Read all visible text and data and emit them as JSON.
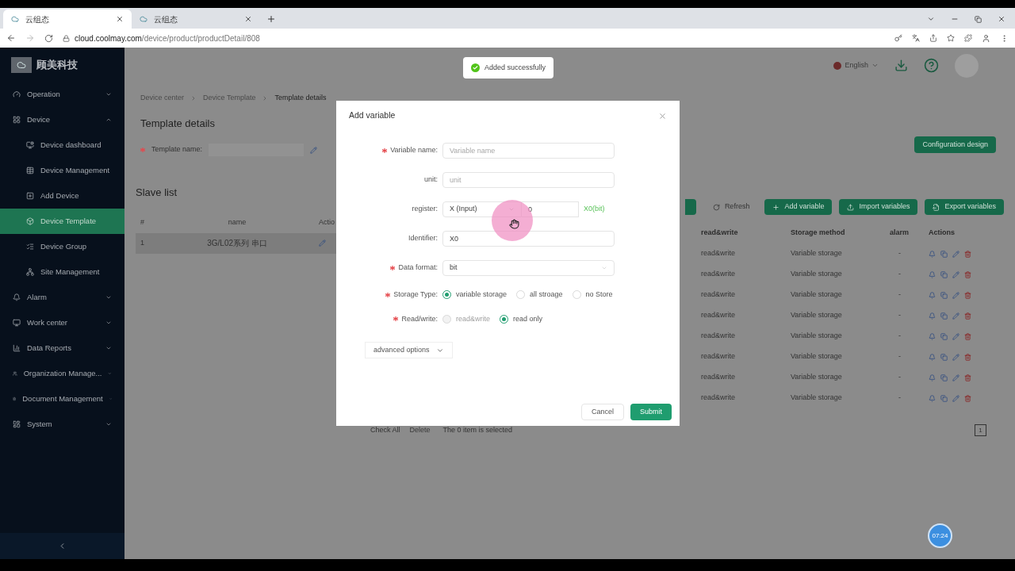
{
  "browser": {
    "tabs": [
      {
        "title": "云组态",
        "selected": true
      },
      {
        "title": "云组态",
        "selected": false
      }
    ],
    "url_host": "cloud.coolmay.com",
    "url_path": "/device/product/productDetail/808"
  },
  "logo_text": "顾美科技",
  "sidebar": [
    {
      "label": "Operation",
      "expanded": false,
      "selected": false
    },
    {
      "label": "Device",
      "expanded": true,
      "selected": false,
      "children": [
        {
          "label": "Device dashboard",
          "selected": false
        },
        {
          "label": "Device Management",
          "selected": false
        },
        {
          "label": "Add Device",
          "selected": false
        },
        {
          "label": "Device Template",
          "selected": true
        },
        {
          "label": "Device Group",
          "selected": false
        },
        {
          "label": "Site Management",
          "selected": false
        }
      ]
    },
    {
      "label": "Alarm",
      "expanded": false,
      "selected": false
    },
    {
      "label": "Work center",
      "expanded": false,
      "selected": false
    },
    {
      "label": "Data Reports",
      "expanded": false,
      "selected": false
    },
    {
      "label": "Organization Manage...",
      "expanded": false,
      "selected": false
    },
    {
      "label": "Document Management",
      "expanded": false,
      "selected": false
    },
    {
      "label": "System",
      "expanded": false,
      "selected": false
    }
  ],
  "header": {
    "language": "English"
  },
  "breadcrumb": [
    "Device center",
    "Device Template",
    "Template details"
  ],
  "page_title": "Template details",
  "template_name_label": "Template name:",
  "configuration_button": "Configuration design",
  "slave_list": {
    "title": "Slave list",
    "columns": [
      "#",
      "name",
      "Actio"
    ],
    "rows": [
      {
        "cells": [
          "1",
          "3G/L02系列 串口"
        ],
        "selected": true
      }
    ]
  },
  "toolbar": [
    {
      "kind": "plain",
      "label": "Refresh"
    },
    {
      "kind": "add",
      "label": "Add variable"
    },
    {
      "kind": "import",
      "label": "Import variables"
    },
    {
      "kind": "export",
      "label": "Export variables"
    }
  ],
  "variables": {
    "columns": [
      "read&write",
      "Storage method",
      "alarm",
      "Actions"
    ],
    "rows": [
      {
        "cells": [
          "read&write",
          "Variable storage",
          "-"
        ]
      },
      {
        "cells": [
          "read&write",
          "Variable storage",
          "-"
        ]
      },
      {
        "cells": [
          "read&write",
          "Variable storage",
          "-"
        ]
      },
      {
        "cells": [
          "read&write",
          "Variable storage",
          "-"
        ]
      },
      {
        "cells": [
          "read&write",
          "Variable storage",
          "-"
        ]
      },
      {
        "cells": [
          "read&write",
          "Variable storage",
          "-"
        ]
      },
      {
        "cells": [
          "read&write",
          "Variable storage",
          "-"
        ]
      },
      {
        "cells": [
          "read&write",
          "Variable storage",
          "-"
        ]
      }
    ]
  },
  "footer": {
    "check_all": "Check All",
    "delete": {
      "label": "Delete",
      "disabled": true
    },
    "selection": "The 0 item is selected",
    "pages": [
      {
        "label": "1",
        "selected": true
      }
    ]
  },
  "toast": "Added successfully",
  "modal": {
    "title": "Add variable",
    "fields": [
      {
        "kind": "text",
        "label": "Variable name:",
        "required": true,
        "placeholder": "Variable name"
      },
      {
        "kind": "text",
        "label": "unit:",
        "required": false,
        "placeholder": "unit"
      },
      {
        "kind": "register",
        "label": "register:",
        "required": false,
        "select": "X (Input)",
        "number": "0",
        "hint": "X0(bit)"
      },
      {
        "kind": "text",
        "label": "Identifier:",
        "required": false,
        "value": "X0"
      },
      {
        "kind": "select",
        "label": "Data format:",
        "required": true,
        "value": "bit"
      },
      {
        "kind": "radio",
        "label": "Storage Type:",
        "required": true,
        "options": [
          {
            "label": "variable storage",
            "selected": true,
            "disabled": false
          },
          {
            "label": "all stroage",
            "selected": false,
            "disabled": false
          },
          {
            "label": "no Store",
            "selected": false,
            "disabled": false
          }
        ]
      },
      {
        "kind": "radio",
        "label": "Read/write:",
        "required": true,
        "options": [
          {
            "label": "read&write",
            "selected": false,
            "disabled": true
          },
          {
            "label": "read only",
            "selected": true,
            "disabled": false
          }
        ]
      }
    ],
    "advanced": "advanced options",
    "cancel": "Cancel",
    "submit": "Submit"
  },
  "timer": "07:24"
}
